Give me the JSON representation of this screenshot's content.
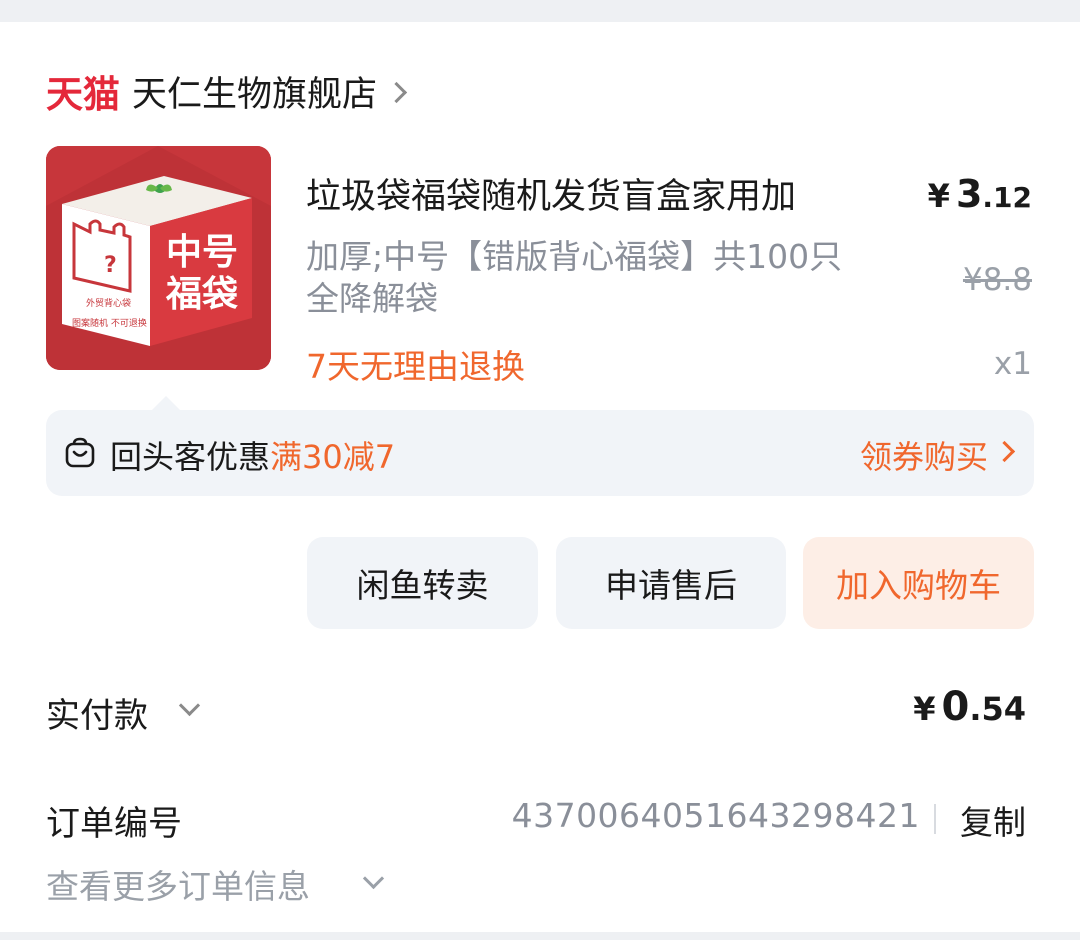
{
  "store": {
    "platform_logo": "天猫",
    "name": "天仁生物旗舰店"
  },
  "product": {
    "image_text": {
      "badge_line1": "中号",
      "badge_line2": "福袋",
      "bag_question": "?",
      "side_text1": "外贸背心袋",
      "side_text2": "图案随机 不可退换"
    },
    "title": "垃圾袋福袋随机发货盲盒家用加",
    "sku": "加厚;中号【错版背心福袋】共100只 全降解袋",
    "tag": "7天无理由退换",
    "price_currency": "¥",
    "price_int": "3",
    "price_dec": ".12",
    "original_price": "¥8.8",
    "quantity": "x1"
  },
  "promo": {
    "label": "回头客优惠",
    "highlight": "满30减7",
    "action": "领券购买",
    "icon": "shopping-bag-icon"
  },
  "actions": {
    "resell": "闲鱼转卖",
    "after_sales": "申请售后",
    "add_to_cart": "加入购物车"
  },
  "payment": {
    "label": "实付款",
    "currency": "¥",
    "amount_int": "0",
    "amount_dec": ".54"
  },
  "order": {
    "label": "订单编号",
    "number": "4370064051643298421",
    "copy": "复制",
    "more": "查看更多订单信息"
  },
  "colors": {
    "brand_red": "#e4283a",
    "accent_orange": "#f0672d",
    "muted": "#8a8f99"
  }
}
